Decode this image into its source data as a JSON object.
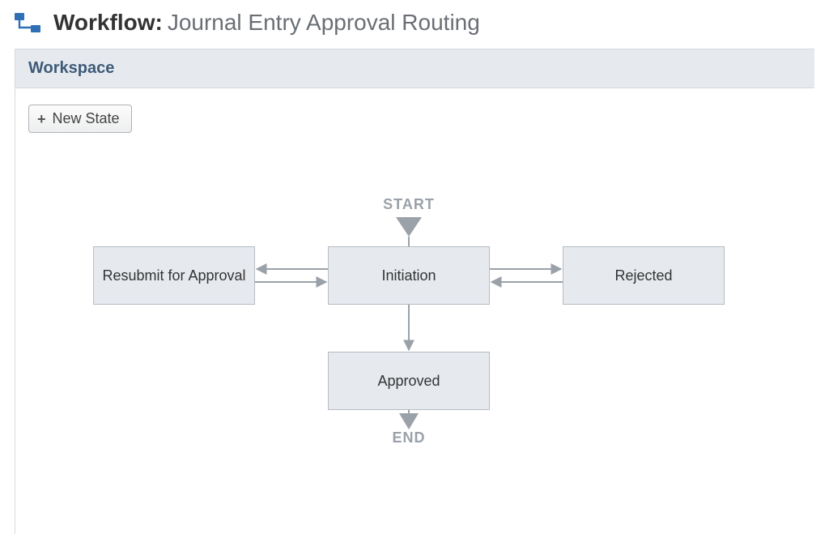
{
  "header": {
    "prefix": "Workflow:",
    "name": "Journal Entry Approval Routing"
  },
  "panel": {
    "title": "Workspace"
  },
  "buttons": {
    "new_state": "New State"
  },
  "diagram": {
    "start_label": "START",
    "end_label": "END",
    "states": {
      "resubmit": "Resubmit for Approval",
      "initiation": "Initiation",
      "rejected": "Rejected",
      "approved": "Approved"
    },
    "transitions": [
      {
        "from": "START",
        "to": "initiation"
      },
      {
        "from": "initiation",
        "to": "resubmit",
        "bidirectional": true
      },
      {
        "from": "initiation",
        "to": "rejected",
        "bidirectional": true
      },
      {
        "from": "initiation",
        "to": "approved"
      },
      {
        "from": "approved",
        "to": "END"
      }
    ]
  }
}
